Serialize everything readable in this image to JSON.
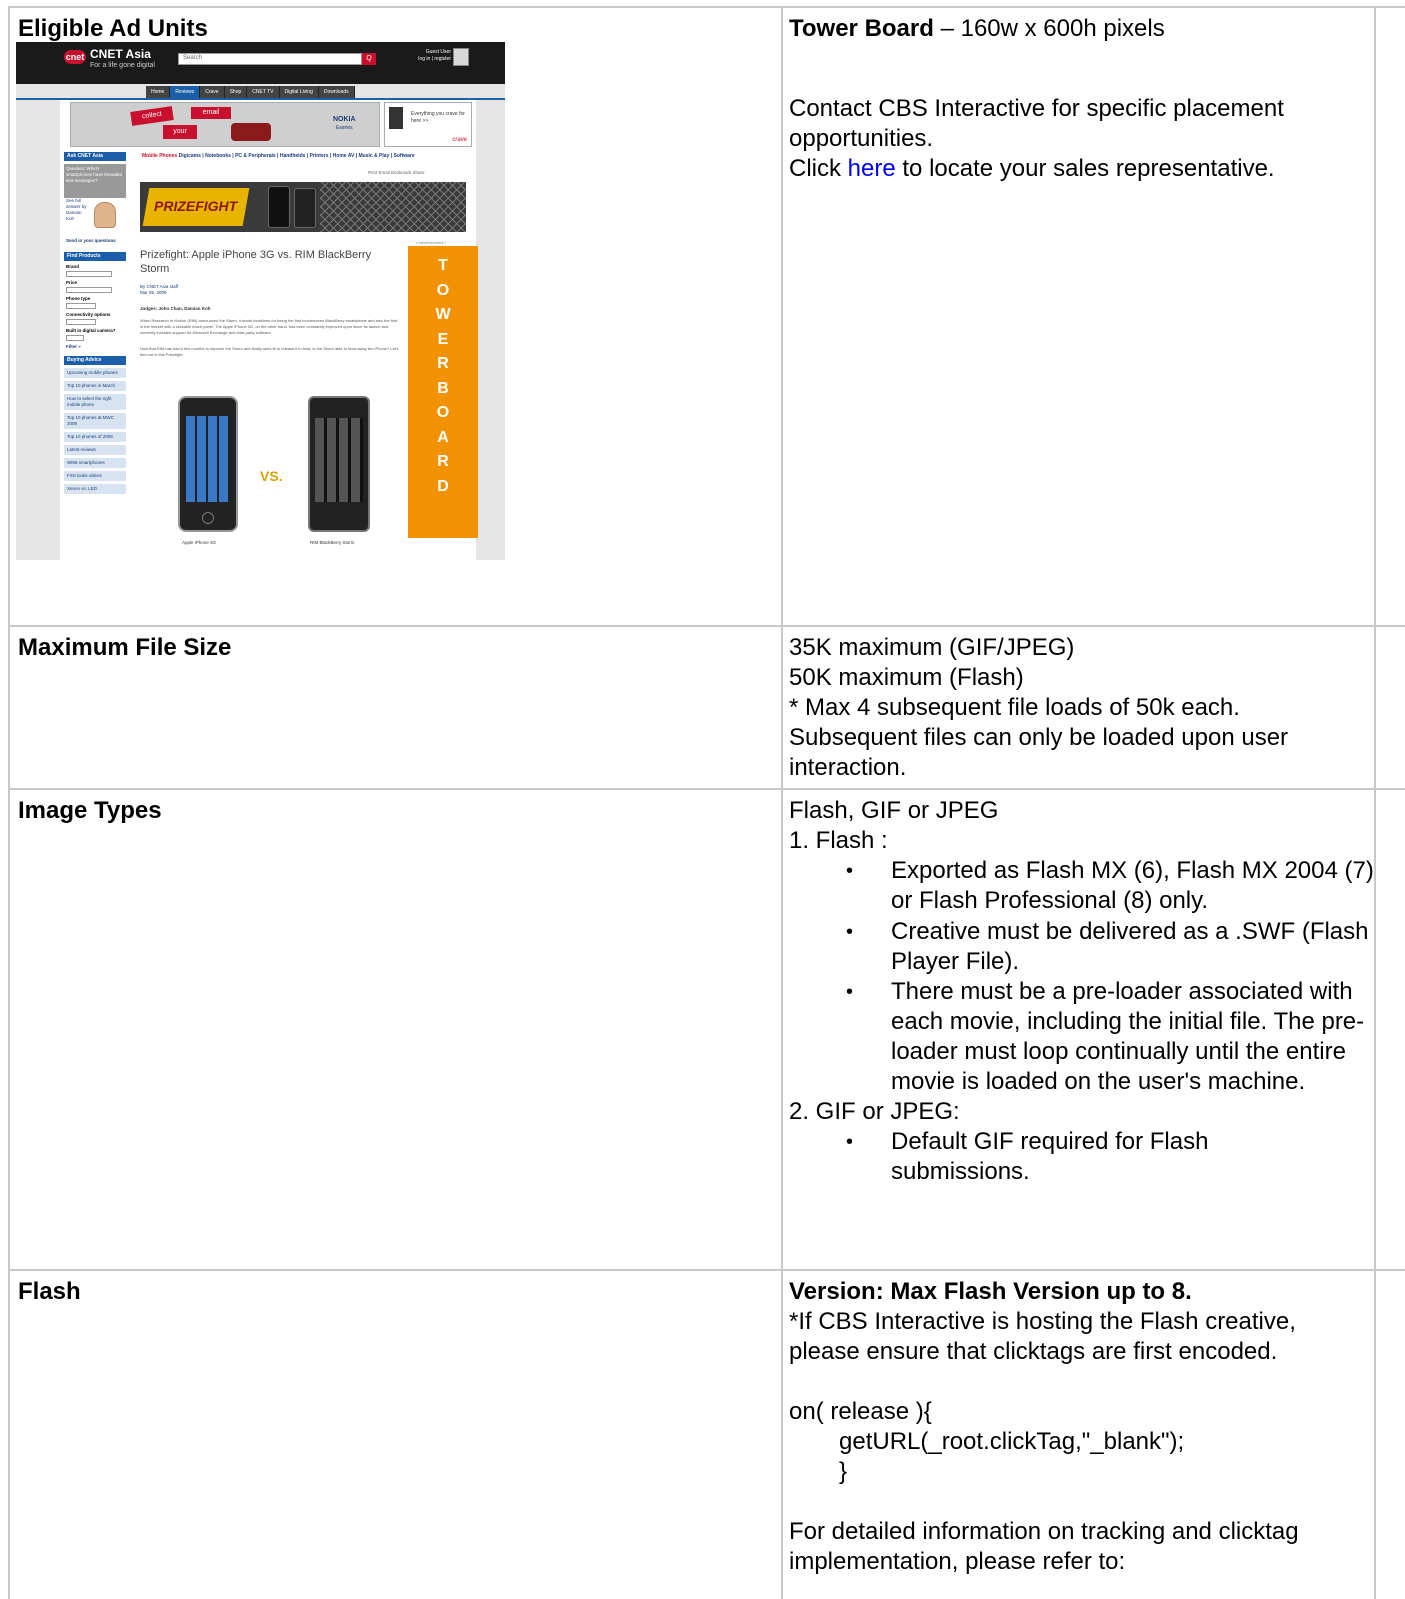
{
  "rows": [
    {
      "label": "Eligible Ad Units",
      "title_bold": "Tower Board",
      "title_rest": " – 160w x 600h pixels",
      "contact": "Contact CBS Interactive for specific placement opportunities.",
      "click_pre": "Click ",
      "click_link": "here",
      "click_post": " to locate your sales representative."
    },
    {
      "label": "Maximum File Size",
      "lines": [
        "35K maximum (GIF/JPEG)",
        "50K maximum (Flash)",
        "* Max 4 subsequent file loads of 50k each. Subsequent files can only be loaded upon user interaction."
      ]
    },
    {
      "label": "Image Types",
      "intro": "Flash, GIF or JPEG",
      "flash_heading": "1. Flash :",
      "flash_items": [
        "Exported as Flash MX (6), Flash MX 2004 (7) or Flash Professional (8) only.",
        "Creative must be delivered as a .SWF (Flash Player File).",
        "There must be a pre-loader associated with each movie, including the initial file. The pre-loader must loop continually until the entire movie is loaded on the user's machine."
      ],
      "gif_heading": "2. GIF or JPEG:",
      "gif_items": [
        "Default GIF required for Flash submissions."
      ]
    },
    {
      "label": "Flash",
      "version": "Version: Max Flash Version up to 8.",
      "note": "*If CBS Interactive is hosting the Flash creative, please ensure that clicktags are first encoded.",
      "code": [
        "on( release ){",
        "getURL(_root.clickTag,\"_blank\");",
        "}"
      ],
      "detail": "For detailed information on tracking and clicktag implementation, please refer to:"
    }
  ],
  "screenshot": {
    "logo": "cnet",
    "brand": "CNET Asia",
    "tagline": "For a life gone digital",
    "search_placeholder": "Search",
    "search_button": "Q",
    "guest": "Guest User",
    "guest_sub": "log in | register",
    "nav": [
      "Home",
      "Reviews",
      "Crave",
      "Shop",
      "CNET TV",
      "Digital Living",
      "Downloads"
    ],
    "banner_collect": "collect",
    "banner_email": "email",
    "banner_your": "your",
    "banner_nokia": "NOKIA",
    "banner_nokia_sub": "Eseries",
    "crave_text": "Everything you crave for here >>",
    "crave_logo": "crave",
    "ask": "Ask CNET Asia",
    "question": "Question: Which smartphones have threaded text messages?",
    "see_full": "See full answer by Damian Koh",
    "send": "Send in your questions",
    "find": "Find Products",
    "brand_lbl": "Brand",
    "price_lbl": "Price",
    "phone_lbl": "Phone type",
    "conn_lbl": "Connectivity options",
    "camera_lbl": "Built in digital camera?",
    "filter": "Filter »",
    "buying": "Buying Advice",
    "advice": [
      "Upcoming mobile phones",
      "Top 10 phones in March",
      "How to select the right mobile phone",
      "Top 10 phones at MWC 2009",
      "Top 10 phones of 2008",
      "Latest reviews",
      "WM6 smartphones",
      "First looks videos",
      "Xenon vs. LED"
    ],
    "cats_red": "Mobile Phones",
    "cats": "Digicams | Notebooks | PC & Peripherals | Handhelds | Printers | Home AV | Music & Play | Software",
    "share": "Print  Email  Bookmark  Share",
    "prize": "PRIZEFIGHT",
    "advert": "• advertisement •",
    "article_title": "Prizefight: Apple iPhone 3G vs. RIM BlackBerry Storm",
    "byline": "By CNET Asia staff",
    "date": "Mar 05, 2009",
    "judges": "Judges: John Chan, Damian Koh",
    "p1": "When Research In Motion (RIM) announced the Storm, it made headlines for being the first touchscreen BlackBerry smartphone and also the first in the market with a clickable touch panel. The Apple iPhone 3G, on the other hand, has been constantly improved upon since its launch and currently includes support for Microsoft Exchange and third-party software.",
    "p2": "Now that RIM has had a few months to improve the Storm and finally sees fit to release it in Asia, is the Storm able to blow away the iPhone? Let's find out in this Prizefight.",
    "tower_letters": [
      "T",
      "O",
      "W",
      "E",
      "R",
      "B",
      "O",
      "A",
      "R",
      "D"
    ],
    "vs": "VS.",
    "cap_iphone": "Apple iPhone 3G",
    "cap_bb": "RIM BlackBerry Storm"
  }
}
